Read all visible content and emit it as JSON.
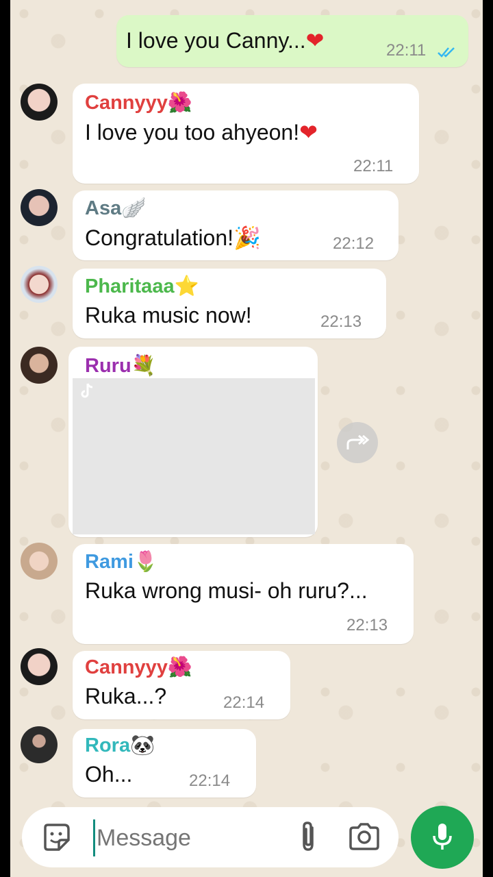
{
  "messages": {
    "m1": {
      "text": "I love you Canny...",
      "emoji": "❤",
      "time": "22:11"
    },
    "m2": {
      "sender": "Cannyyy",
      "sender_emoji": "🌺",
      "text": "I love you too ahyeon!",
      "emoji": "❤",
      "time": "22:11"
    },
    "m3": {
      "sender": "Asa",
      "sender_emoji": "🪽",
      "text": "Congratulation!",
      "emoji": "🎉",
      "time": "22:12"
    },
    "m4": {
      "sender": "Pharitaaa",
      "sender_emoji": "⭐",
      "text": "Ruka music now!",
      "time": "22:13"
    },
    "m5": {
      "sender": "Ruru",
      "sender_emoji": "💐"
    },
    "m6": {
      "sender": "Rami",
      "sender_emoji": "🌷",
      "text": "Ruka wrong musi- oh ruru?...",
      "time": "22:13"
    },
    "m7": {
      "sender": "Cannyyy",
      "sender_emoji": "🌺",
      "text": "Ruka...?",
      "time": "22:14"
    },
    "m8": {
      "sender": "Rora",
      "sender_emoji": "🐼",
      "text": "Oh...",
      "time": "22:14"
    }
  },
  "composer": {
    "placeholder": "Message"
  },
  "icons": {
    "read_receipt": "double-check-icon",
    "forward": "forward-icon",
    "sticker": "sticker-icon",
    "attach": "paperclip-icon",
    "camera": "camera-icon",
    "mic": "microphone-icon"
  },
  "colors": {
    "outgoing_bubble": "#dbf8c6",
    "incoming_bubble": "#ffffff",
    "mic_button": "#1fa855",
    "read_check": "#34b7f1",
    "cannyyy": "#e0403f",
    "asa": "#5f7b84",
    "pharitaaa": "#4cb84c",
    "ruru": "#9b2fae",
    "rami": "#3f9ae0",
    "rora": "#32b8bb"
  }
}
